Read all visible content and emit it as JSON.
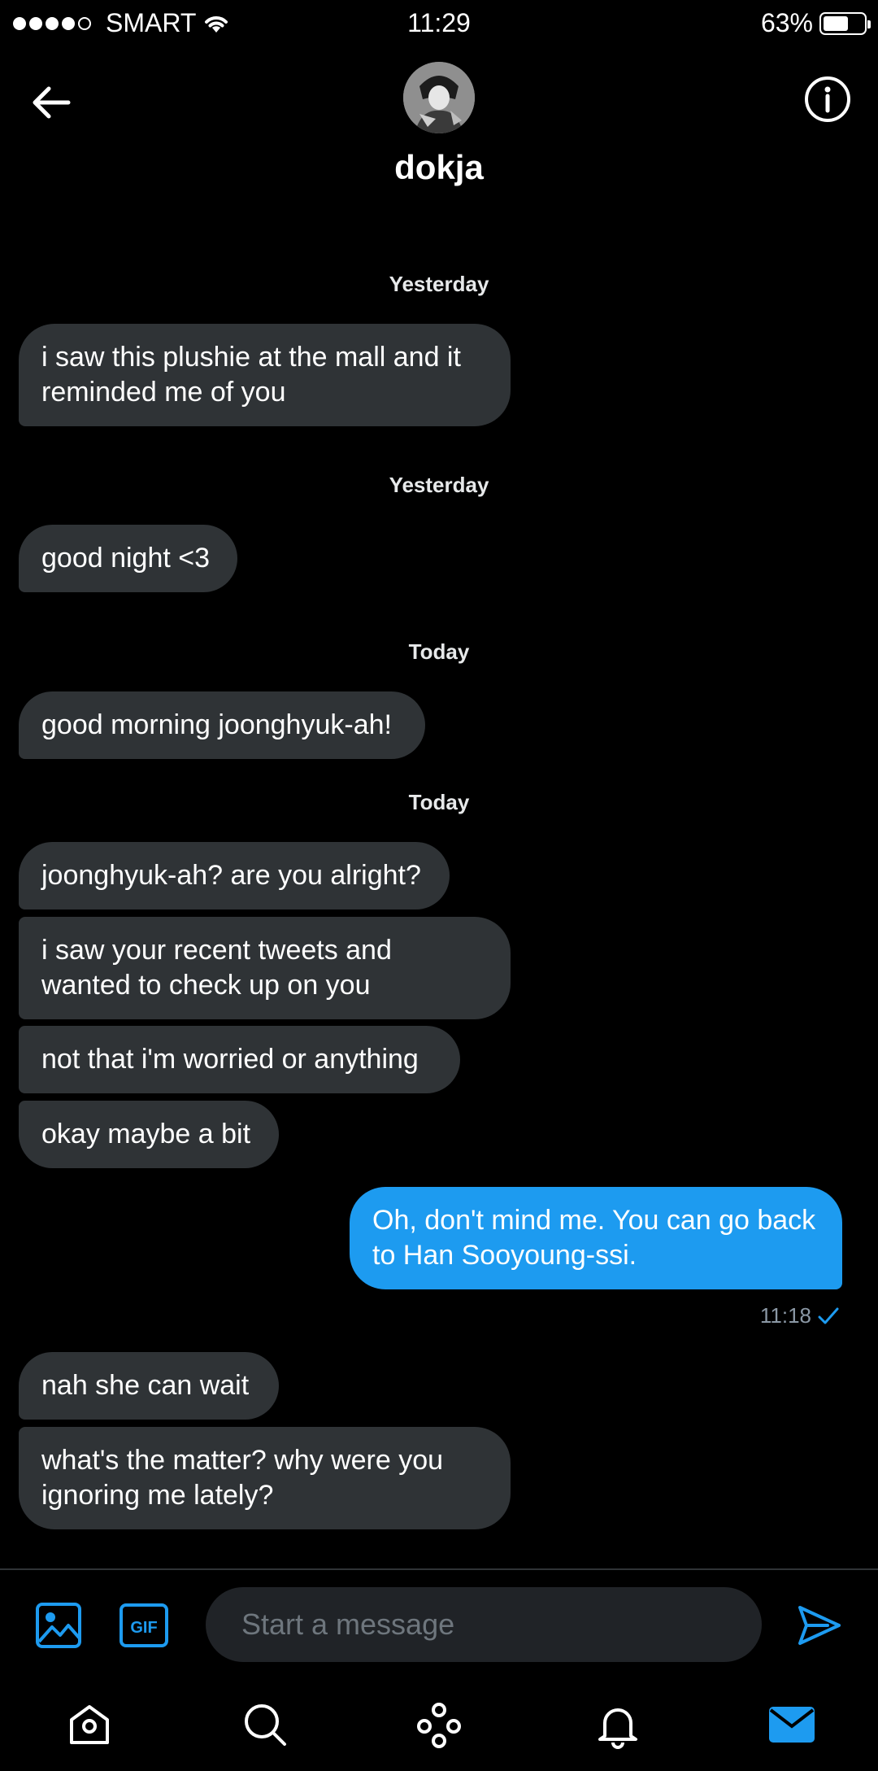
{
  "status_bar": {
    "carrier": "SMART",
    "time": "11:29",
    "battery_percent": "63%",
    "battery_level": 0.63,
    "signal_bars_filled": 4,
    "signal_bars_total": 5
  },
  "header": {
    "contact_name": "dokja",
    "back_icon": "arrow-left-icon",
    "info_icon": "info-icon"
  },
  "messages": [
    {
      "type": "timestamp",
      "text": "Yesterday"
    },
    {
      "type": "received",
      "text": "i saw this plushie at the mall and it reminded me of you"
    },
    {
      "type": "timestamp",
      "text": "Yesterday"
    },
    {
      "type": "received",
      "text": "good night <3"
    },
    {
      "type": "timestamp",
      "text": "Today"
    },
    {
      "type": "received",
      "text": "good morning joonghyuk-ah!"
    },
    {
      "type": "timestamp",
      "text": "Today"
    },
    {
      "type": "received",
      "text": "joonghyuk-ah? are you alright?"
    },
    {
      "type": "received",
      "text": "i saw your recent tweets and wanted to check up on you"
    },
    {
      "type": "received",
      "text": "not that i'm worried or anything"
    },
    {
      "type": "received",
      "text": "okay maybe a bit"
    },
    {
      "type": "sent",
      "text": "Oh, don't mind me. You can go back to Han Sooyoung-ssi.",
      "time": "11:18"
    },
    {
      "type": "received",
      "text": "nah she can wait"
    },
    {
      "type": "received",
      "text": "what's the matter? why were you ignoring me lately?"
    }
  ],
  "composer": {
    "placeholder": "Start a message",
    "gif_label": "GIF"
  },
  "bottom_nav": [
    "home-icon",
    "search-icon",
    "spaces-icon",
    "notifications-icon",
    "messages-icon"
  ],
  "colors": {
    "accent": "#1d9bf0",
    "received_bubble": "#2f3336",
    "background": "#000000"
  }
}
